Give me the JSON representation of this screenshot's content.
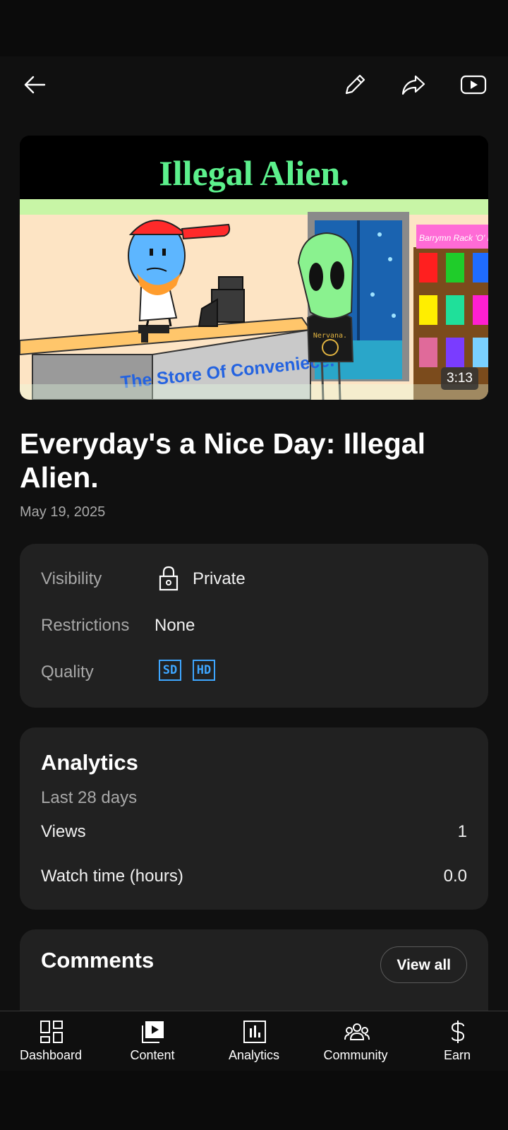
{
  "video": {
    "title": "Everyday's a Nice Day: Illegal Alien.",
    "date": "May 19, 2025",
    "duration": "3:13",
    "thumbnail": {
      "banner_text": "Illegal Alien.",
      "counter_text": "The Store Of Conveniece.",
      "shop_sign": "Barrymn Rack 'O' DVDs!",
      "shirt_text": "Nervana."
    }
  },
  "info": {
    "visibility_label": "Visibility",
    "visibility_value": "Private",
    "restrictions_label": "Restrictions",
    "restrictions_value": "None",
    "quality_label": "Quality",
    "quality_badges": [
      "SD",
      "HD"
    ]
  },
  "analytics": {
    "title": "Analytics",
    "period": "Last 28 days",
    "rows": [
      {
        "label": "Views",
        "value": "1"
      },
      {
        "label": "Watch time (hours)",
        "value": "0.0"
      }
    ]
  },
  "comments": {
    "title": "Comments",
    "view_all": "View all"
  },
  "nav": {
    "items": [
      {
        "label": "Dashboard",
        "icon": "dashboard-icon"
      },
      {
        "label": "Content",
        "icon": "content-icon"
      },
      {
        "label": "Analytics",
        "icon": "analytics-icon"
      },
      {
        "label": "Community",
        "icon": "community-icon"
      },
      {
        "label": "Earn",
        "icon": "earn-icon"
      }
    ]
  },
  "colors": {
    "background": "#101010",
    "card": "#212121",
    "accent_blue": "#3ea6ff",
    "banner_green": "#5cf08c"
  }
}
